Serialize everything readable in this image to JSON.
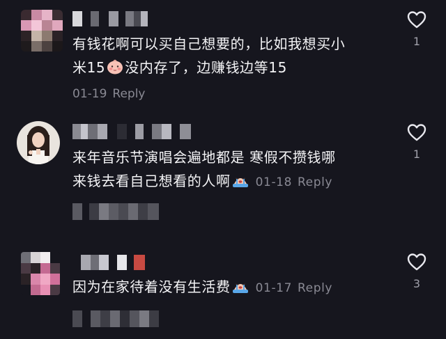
{
  "comments": [
    {
      "text_line1": "有钱花啊可以买自己想要的，比如我想买小",
      "text_line2_a": "米15",
      "text_line2_b": "没内存了，边赚钱边等15",
      "date": "01-19",
      "reply_label": "Reply",
      "like_count": "1",
      "emoji": "baby-face-emoji"
    },
    {
      "text_line1": "来年音乐节演唱会遍地都是 寒假不攒钱哪",
      "text_line2": "来钱去看自己想看的人啊",
      "date": "01-18",
      "reply_label": "Reply",
      "like_count": "1",
      "emoji": "crying-emoji"
    },
    {
      "text_line1": "因为在家待着没有生活费",
      "date": "01-17",
      "reply_label": "Reply",
      "like_count": "3",
      "emoji": "crying-emoji"
    }
  ],
  "colors": {
    "background": "#16161e",
    "text": "#f4f4f6",
    "meta": "#8a8a94"
  },
  "icons": {
    "like": "heart-outline-icon"
  }
}
